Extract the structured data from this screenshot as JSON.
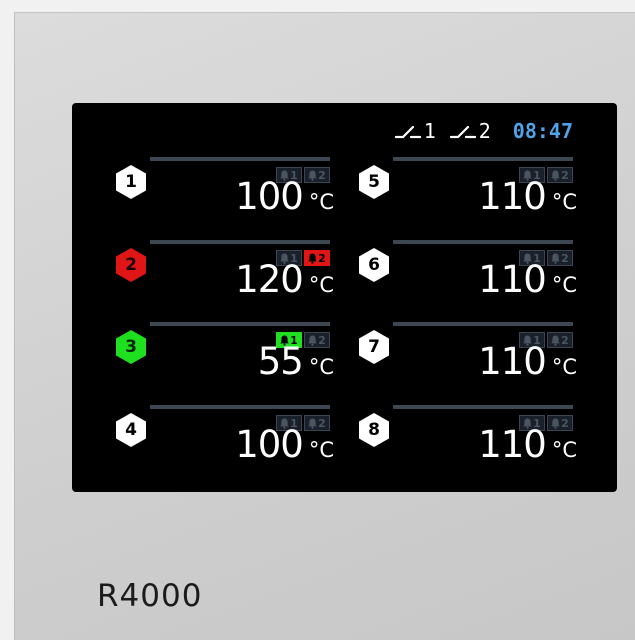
{
  "status": {
    "relays": [
      {
        "label": "1",
        "icon": "relay-contact-icon"
      },
      {
        "label": "2",
        "icon": "relay-contact-icon"
      }
    ],
    "time": "08:47",
    "time_color": "#4fa3ea"
  },
  "channels": [
    {
      "number": "1",
      "value": "100",
      "unit": "°C",
      "state": "normal",
      "alarm1": {
        "label": "1",
        "state": "off"
      },
      "alarm2": {
        "label": "2",
        "state": "off"
      }
    },
    {
      "number": "2",
      "value": "120",
      "unit": "°C",
      "state": "alarm-red",
      "alarm1": {
        "label": "1",
        "state": "off"
      },
      "alarm2": {
        "label": "2",
        "state": "red"
      }
    },
    {
      "number": "3",
      "value": "55",
      "unit": "°C",
      "state": "alarm-green",
      "alarm1": {
        "label": "1",
        "state": "green"
      },
      "alarm2": {
        "label": "2",
        "state": "off"
      }
    },
    {
      "number": "4",
      "value": "100",
      "unit": "°C",
      "state": "normal",
      "alarm1": {
        "label": "1",
        "state": "off"
      },
      "alarm2": {
        "label": "2",
        "state": "off"
      }
    },
    {
      "number": "5",
      "value": "110",
      "unit": "°C",
      "state": "normal",
      "alarm1": {
        "label": "1",
        "state": "off"
      },
      "alarm2": {
        "label": "2",
        "state": "off"
      }
    },
    {
      "number": "6",
      "value": "110",
      "unit": "°C",
      "state": "normal",
      "alarm1": {
        "label": "1",
        "state": "off"
      },
      "alarm2": {
        "label": "2",
        "state": "off"
      }
    },
    {
      "number": "7",
      "value": "110",
      "unit": "°C",
      "state": "normal",
      "alarm1": {
        "label": "1",
        "state": "off"
      },
      "alarm2": {
        "label": "2",
        "state": "off"
      }
    },
    {
      "number": "8",
      "value": "110",
      "unit": "°C",
      "state": "normal",
      "alarm1": {
        "label": "1",
        "state": "off"
      },
      "alarm2": {
        "label": "2",
        "state": "off"
      }
    }
  ],
  "colors": {
    "badge_normal": "#ffffff",
    "badge_red": "#e01515",
    "badge_green": "#1ee01e",
    "screen_background": "#000000",
    "accent_time": "#4fa3ea"
  },
  "device": {
    "model": "R4000"
  }
}
